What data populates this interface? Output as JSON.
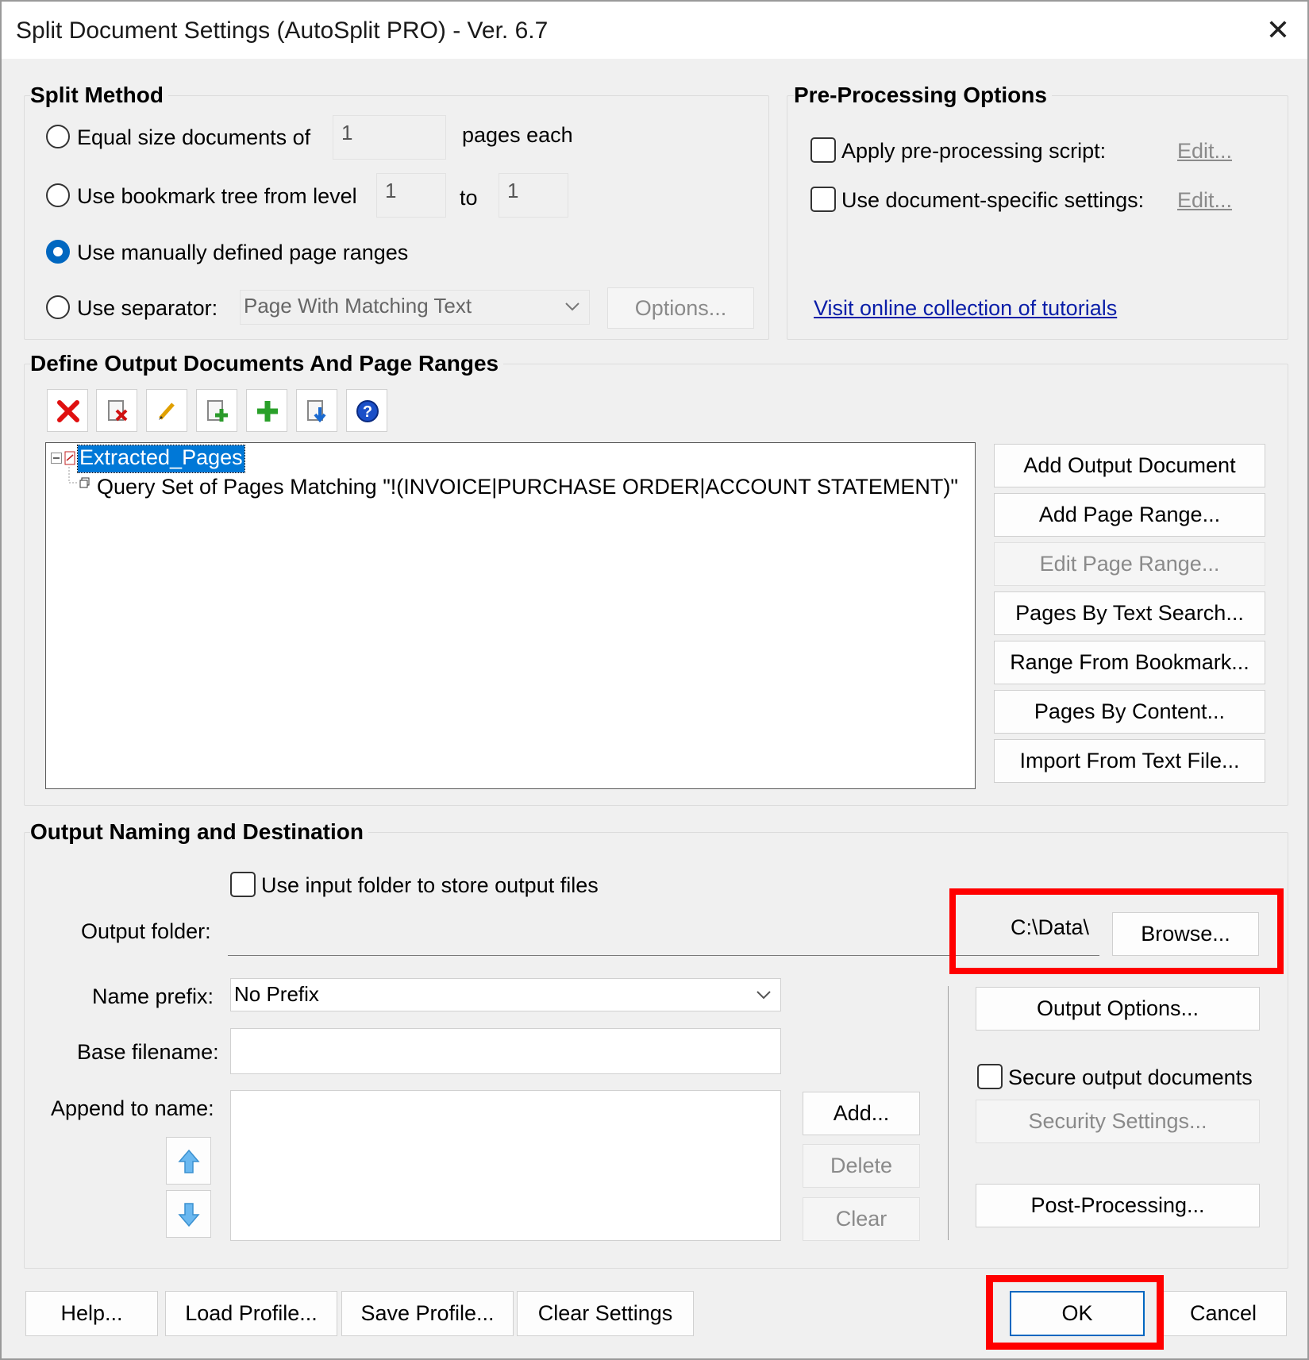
{
  "window": {
    "title": "Split Document Settings (AutoSplit PRO) - Ver. 6.7"
  },
  "split_method": {
    "title": "Split Method",
    "equal_size_label": "Equal size documents of",
    "equal_size_value": "1",
    "pages_each_label": "pages each",
    "bookmark_label": "Use bookmark tree from level",
    "bookmark_from": "1",
    "to_label": "to",
    "bookmark_to": "1",
    "manual_label": "Use manually defined page ranges",
    "separator_label": "Use separator:",
    "separator_value": "Page With Matching Text",
    "options_button": "Options..."
  },
  "pre_processing": {
    "title": "Pre-Processing Options",
    "script_label": "Apply pre-processing script:",
    "script_edit": "Edit...",
    "specific_label": "Use document-specific settings:",
    "specific_edit": "Edit...",
    "tutorials_link": "Visit online collection of tutorials"
  },
  "define_output": {
    "title": "Define Output Documents And Page Ranges",
    "tree": {
      "root": "Extracted_Pages",
      "child": "Query Set of Pages Matching \"!(INVOICE|PURCHASE ORDER|ACCOUNT STATEMENT)\""
    },
    "buttons": {
      "add_output": "Add Output Document",
      "add_range": "Add Page Range...",
      "edit_range": "Edit Page Range...",
      "text_search": "Pages By Text Search...",
      "from_bookmark": "Range From Bookmark...",
      "by_content": "Pages By Content...",
      "import_text": "Import From Text File..."
    }
  },
  "output_naming": {
    "title": "Output Naming and Destination",
    "use_input_folder_label": "Use input folder to store output files",
    "output_folder_label": "Output folder:",
    "output_folder_value": "C:\\Data\\",
    "browse_button": "Browse...",
    "name_prefix_label": "Name prefix:",
    "name_prefix_value": "No Prefix",
    "base_filename_label": "Base filename:",
    "base_filename_value": "",
    "append_label": "Append to name:",
    "add_button": "Add...",
    "delete_button": "Delete",
    "clear_button": "Clear",
    "output_options_button": "Output Options...",
    "secure_label": "Secure output documents",
    "security_settings_button": "Security Settings...",
    "post_processing_button": "Post-Processing..."
  },
  "footer": {
    "help": "Help...",
    "load_profile": "Load Profile...",
    "save_profile": "Save Profile...",
    "clear_settings": "Clear Settings",
    "ok": "OK",
    "cancel": "Cancel"
  },
  "colors": {
    "accent": "#0067c0",
    "highlight_outline": "#ff0000",
    "link": "#0a1ea8",
    "selection": "#0078d7"
  }
}
